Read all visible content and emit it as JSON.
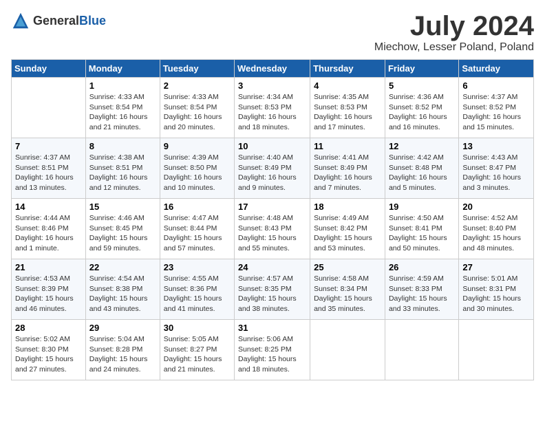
{
  "header": {
    "logo_general": "General",
    "logo_blue": "Blue",
    "title": "July 2024",
    "subtitle": "Miechow, Lesser Poland, Poland"
  },
  "days_of_week": [
    "Sunday",
    "Monday",
    "Tuesday",
    "Wednesday",
    "Thursday",
    "Friday",
    "Saturday"
  ],
  "weeks": [
    [
      {
        "day": "",
        "sunrise": "",
        "sunset": "",
        "daylight": ""
      },
      {
        "day": "1",
        "sunrise": "Sunrise: 4:33 AM",
        "sunset": "Sunset: 8:54 PM",
        "daylight": "Daylight: 16 hours and 21 minutes."
      },
      {
        "day": "2",
        "sunrise": "Sunrise: 4:33 AM",
        "sunset": "Sunset: 8:54 PM",
        "daylight": "Daylight: 16 hours and 20 minutes."
      },
      {
        "day": "3",
        "sunrise": "Sunrise: 4:34 AM",
        "sunset": "Sunset: 8:53 PM",
        "daylight": "Daylight: 16 hours and 18 minutes."
      },
      {
        "day": "4",
        "sunrise": "Sunrise: 4:35 AM",
        "sunset": "Sunset: 8:53 PM",
        "daylight": "Daylight: 16 hours and 17 minutes."
      },
      {
        "day": "5",
        "sunrise": "Sunrise: 4:36 AM",
        "sunset": "Sunset: 8:52 PM",
        "daylight": "Daylight: 16 hours and 16 minutes."
      },
      {
        "day": "6",
        "sunrise": "Sunrise: 4:37 AM",
        "sunset": "Sunset: 8:52 PM",
        "daylight": "Daylight: 16 hours and 15 minutes."
      }
    ],
    [
      {
        "day": "7",
        "sunrise": "Sunrise: 4:37 AM",
        "sunset": "Sunset: 8:51 PM",
        "daylight": "Daylight: 16 hours and 13 minutes."
      },
      {
        "day": "8",
        "sunrise": "Sunrise: 4:38 AM",
        "sunset": "Sunset: 8:51 PM",
        "daylight": "Daylight: 16 hours and 12 minutes."
      },
      {
        "day": "9",
        "sunrise": "Sunrise: 4:39 AM",
        "sunset": "Sunset: 8:50 PM",
        "daylight": "Daylight: 16 hours and 10 minutes."
      },
      {
        "day": "10",
        "sunrise": "Sunrise: 4:40 AM",
        "sunset": "Sunset: 8:49 PM",
        "daylight": "Daylight: 16 hours and 9 minutes."
      },
      {
        "day": "11",
        "sunrise": "Sunrise: 4:41 AM",
        "sunset": "Sunset: 8:49 PM",
        "daylight": "Daylight: 16 hours and 7 minutes."
      },
      {
        "day": "12",
        "sunrise": "Sunrise: 4:42 AM",
        "sunset": "Sunset: 8:48 PM",
        "daylight": "Daylight: 16 hours and 5 minutes."
      },
      {
        "day": "13",
        "sunrise": "Sunrise: 4:43 AM",
        "sunset": "Sunset: 8:47 PM",
        "daylight": "Daylight: 16 hours and 3 minutes."
      }
    ],
    [
      {
        "day": "14",
        "sunrise": "Sunrise: 4:44 AM",
        "sunset": "Sunset: 8:46 PM",
        "daylight": "Daylight: 16 hours and 1 minute."
      },
      {
        "day": "15",
        "sunrise": "Sunrise: 4:46 AM",
        "sunset": "Sunset: 8:45 PM",
        "daylight": "Daylight: 15 hours and 59 minutes."
      },
      {
        "day": "16",
        "sunrise": "Sunrise: 4:47 AM",
        "sunset": "Sunset: 8:44 PM",
        "daylight": "Daylight: 15 hours and 57 minutes."
      },
      {
        "day": "17",
        "sunrise": "Sunrise: 4:48 AM",
        "sunset": "Sunset: 8:43 PM",
        "daylight": "Daylight: 15 hours and 55 minutes."
      },
      {
        "day": "18",
        "sunrise": "Sunrise: 4:49 AM",
        "sunset": "Sunset: 8:42 PM",
        "daylight": "Daylight: 15 hours and 53 minutes."
      },
      {
        "day": "19",
        "sunrise": "Sunrise: 4:50 AM",
        "sunset": "Sunset: 8:41 PM",
        "daylight": "Daylight: 15 hours and 50 minutes."
      },
      {
        "day": "20",
        "sunrise": "Sunrise: 4:52 AM",
        "sunset": "Sunset: 8:40 PM",
        "daylight": "Daylight: 15 hours and 48 minutes."
      }
    ],
    [
      {
        "day": "21",
        "sunrise": "Sunrise: 4:53 AM",
        "sunset": "Sunset: 8:39 PM",
        "daylight": "Daylight: 15 hours and 46 minutes."
      },
      {
        "day": "22",
        "sunrise": "Sunrise: 4:54 AM",
        "sunset": "Sunset: 8:38 PM",
        "daylight": "Daylight: 15 hours and 43 minutes."
      },
      {
        "day": "23",
        "sunrise": "Sunrise: 4:55 AM",
        "sunset": "Sunset: 8:36 PM",
        "daylight": "Daylight: 15 hours and 41 minutes."
      },
      {
        "day": "24",
        "sunrise": "Sunrise: 4:57 AM",
        "sunset": "Sunset: 8:35 PM",
        "daylight": "Daylight: 15 hours and 38 minutes."
      },
      {
        "day": "25",
        "sunrise": "Sunrise: 4:58 AM",
        "sunset": "Sunset: 8:34 PM",
        "daylight": "Daylight: 15 hours and 35 minutes."
      },
      {
        "day": "26",
        "sunrise": "Sunrise: 4:59 AM",
        "sunset": "Sunset: 8:33 PM",
        "daylight": "Daylight: 15 hours and 33 minutes."
      },
      {
        "day": "27",
        "sunrise": "Sunrise: 5:01 AM",
        "sunset": "Sunset: 8:31 PM",
        "daylight": "Daylight: 15 hours and 30 minutes."
      }
    ],
    [
      {
        "day": "28",
        "sunrise": "Sunrise: 5:02 AM",
        "sunset": "Sunset: 8:30 PM",
        "daylight": "Daylight: 15 hours and 27 minutes."
      },
      {
        "day": "29",
        "sunrise": "Sunrise: 5:04 AM",
        "sunset": "Sunset: 8:28 PM",
        "daylight": "Daylight: 15 hours and 24 minutes."
      },
      {
        "day": "30",
        "sunrise": "Sunrise: 5:05 AM",
        "sunset": "Sunset: 8:27 PM",
        "daylight": "Daylight: 15 hours and 21 minutes."
      },
      {
        "day": "31",
        "sunrise": "Sunrise: 5:06 AM",
        "sunset": "Sunset: 8:25 PM",
        "daylight": "Daylight: 15 hours and 18 minutes."
      },
      {
        "day": "",
        "sunrise": "",
        "sunset": "",
        "daylight": ""
      },
      {
        "day": "",
        "sunrise": "",
        "sunset": "",
        "daylight": ""
      },
      {
        "day": "",
        "sunrise": "",
        "sunset": "",
        "daylight": ""
      }
    ]
  ]
}
